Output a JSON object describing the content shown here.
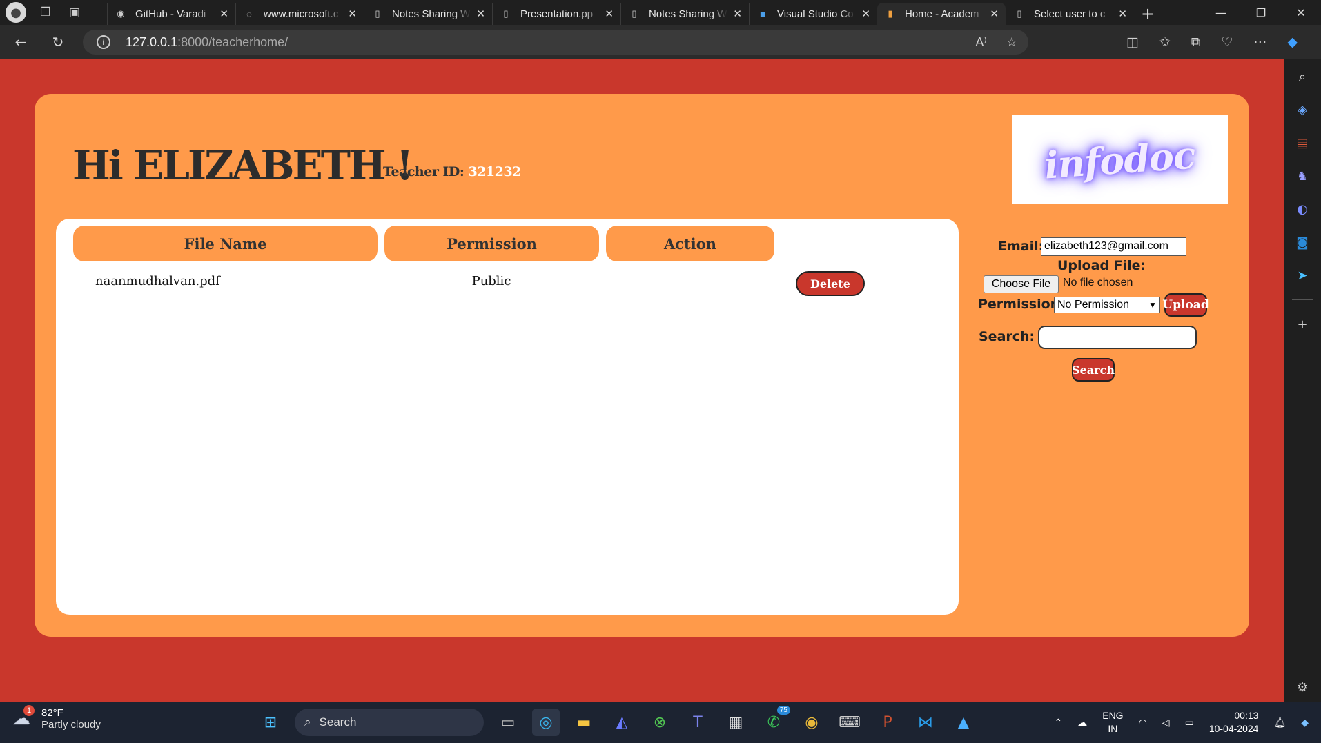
{
  "browser": {
    "tabs": [
      {
        "title": "GitHub - Varadi",
        "icon": "github-icon"
      },
      {
        "title": "www.microsoft.c",
        "icon": "page-icon"
      },
      {
        "title": "Notes Sharing W",
        "icon": "page-icon"
      },
      {
        "title": "Presentation.pp",
        "icon": "page-icon"
      },
      {
        "title": "Notes Sharing W",
        "icon": "page-icon"
      },
      {
        "title": "Visual Studio Co",
        "icon": "vs-icon"
      },
      {
        "title": "Home - Academ",
        "icon": "book-icon",
        "active": true
      },
      {
        "title": "Select user to c",
        "icon": "page-icon"
      }
    ],
    "url_host": "127.0.0.1",
    "url_path": ":8000/teacherhome/"
  },
  "page": {
    "greeting": "Hi ELIZABETH !",
    "teacher_id_label": "Teacher ID:",
    "teacher_id_value": "321232",
    "logo_text": "infodoc",
    "table": {
      "headers": [
        "File Name",
        "Permission",
        "Action"
      ],
      "rows": [
        {
          "file_name": "naanmudhalvan.pdf",
          "permission": "Public",
          "action": "Delete"
        }
      ]
    },
    "form": {
      "email_label": "Email:",
      "email_value": "elizabeth123@gmail.com",
      "upload_label": "Upload File:",
      "choose_file": "Choose File",
      "no_file": "No file chosen",
      "permission_label": "Permission:",
      "permission_selected": "No Permission",
      "upload_button": "Upload",
      "search_label": "Search:",
      "search_value": "",
      "search_button": "Search"
    }
  },
  "taskbar": {
    "weather_temp": "82°F",
    "weather_desc": "Partly cloudy",
    "weather_badge": "1",
    "search_label": "Search",
    "whatsapp_badge": "75",
    "lang_top": "ENG",
    "lang_bottom": "IN",
    "time": "00:13",
    "date": "10-04-2024"
  },
  "colors": {
    "page_bg": "#c9372c",
    "card_bg": "#ff9a4a",
    "button_bg": "#c9372c"
  }
}
